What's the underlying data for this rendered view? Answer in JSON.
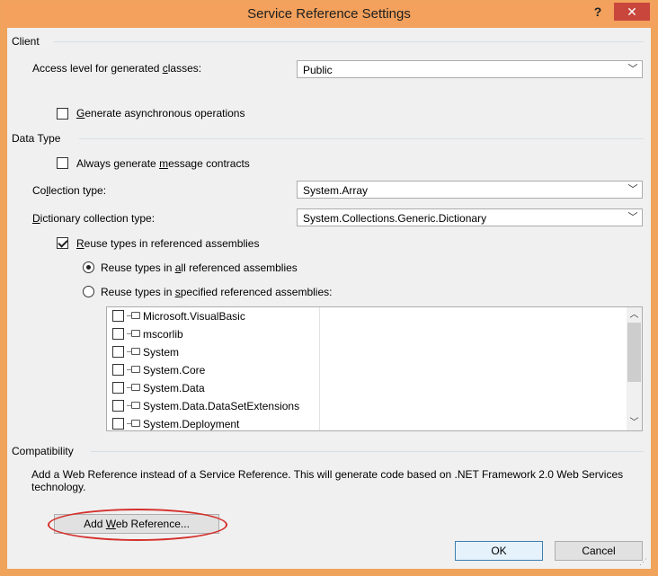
{
  "window": {
    "title": "Service Reference Settings",
    "help_label": "?",
    "close_label": "✕"
  },
  "client": {
    "group_label": "Client",
    "access_level_label_pre": "Access level for generated ",
    "access_level_label_u": "c",
    "access_level_label_post": "lasses:",
    "access_level_value": "Public",
    "async_pre": "",
    "async_u": "G",
    "async_post": "enerate asynchronous operations",
    "async_checked": false
  },
  "data_type": {
    "group_label": "Data Type",
    "msg_contracts_pre": "Always generate ",
    "msg_contracts_u": "m",
    "msg_contracts_post": "essage contracts",
    "msg_contracts_checked": false,
    "collection_label_pre": "Co",
    "collection_label_u": "l",
    "collection_label_post": "lection type:",
    "collection_value": "System.Array",
    "dictionary_label_pre": "",
    "dictionary_label_u": "D",
    "dictionary_label_post": "ictionary collection type:",
    "dictionary_value": "System.Collections.Generic.Dictionary",
    "reuse_pre": "",
    "reuse_u": "R",
    "reuse_post": "euse types in referenced assemblies",
    "reuse_checked": true,
    "reuse_all_pre": "Reuse types in ",
    "reuse_all_u": "a",
    "reuse_all_post": "ll referenced assemblies",
    "reuse_specified_pre": "Reuse types in ",
    "reuse_specified_u": "s",
    "reuse_specified_post": "pecified referenced assemblies:",
    "assemblies": [
      "Microsoft.VisualBasic",
      "mscorlib",
      "System",
      "System.Core",
      "System.Data",
      "System.Data.DataSetExtensions",
      "System.Deployment"
    ]
  },
  "compatibility": {
    "group_label": "Compatibility",
    "description": "Add a Web Reference instead of a Service Reference. This will generate code based on .NET Framework 2.0 Web Services technology.",
    "add_web_ref_pre": "Add ",
    "add_web_ref_u": "W",
    "add_web_ref_post": "eb Reference..."
  },
  "buttons": {
    "ok": "OK",
    "cancel": "Cancel"
  },
  "colors": {
    "titlebar": "#f3a15c",
    "close_button": "#c9463d",
    "callout": "#d4302c"
  }
}
